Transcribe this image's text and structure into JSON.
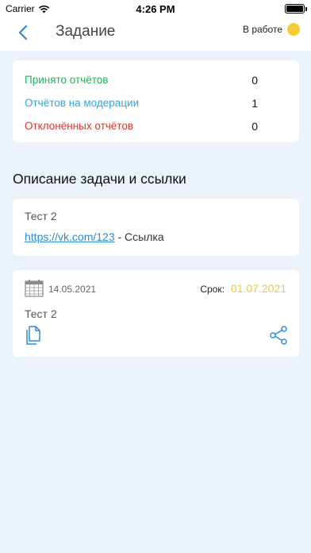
{
  "statusbar": {
    "carrier": "Carrier",
    "time": "4:26 PM"
  },
  "navbar": {
    "title": "Задание",
    "status_label": "В работе",
    "status_color": "#f5cc35"
  },
  "stats": [
    {
      "label": "Принято отчётов",
      "value": "0",
      "color": "#1fb35a"
    },
    {
      "label": "Отчётов на модерации",
      "value": "1",
      "color": "#2ea6dd"
    },
    {
      "label": "Отклонённых отчётов",
      "value": "0",
      "color": "#e2302b"
    }
  ],
  "section": {
    "title": "Описание задачи и ссылки"
  },
  "description": {
    "title": "Тест 2",
    "link_url": "https://vk.com/123",
    "link_suffix": " - Ссылка"
  },
  "task": {
    "date": "14.05.2021",
    "deadline_label": "Срок:",
    "deadline_value": "01.07.2021",
    "title": "Тест 2"
  },
  "icons": {
    "back": "chevron-left-icon",
    "calendar": "calendar-icon",
    "documents": "documents-icon",
    "share": "share-icon",
    "wifi": "wifi-icon",
    "battery": "battery-icon"
  }
}
